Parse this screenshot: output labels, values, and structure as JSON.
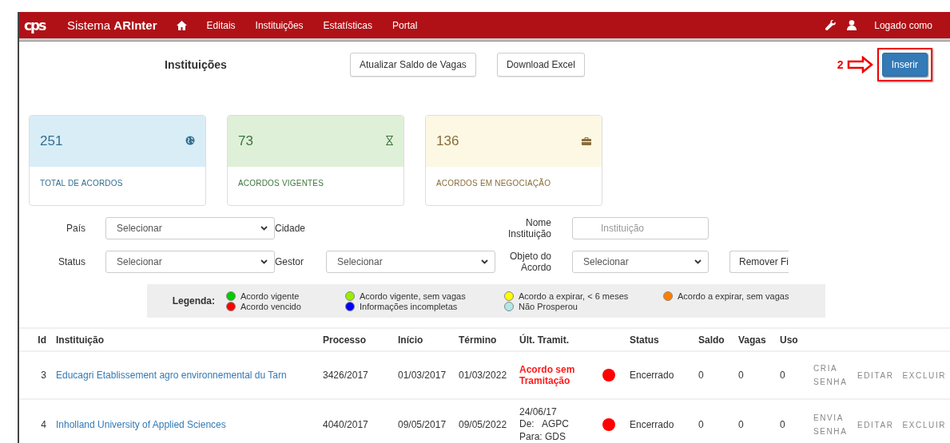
{
  "navbar": {
    "logo": "cps",
    "brand": "Sistema **ARInter**",
    "links": [
      "Editais",
      "Instituições",
      "Estatísticas",
      "Portal"
    ],
    "user_label": "Logado como"
  },
  "page_title": "Instituições",
  "toolbar_buttons": [
    "Atualizar Saldo de Vagas",
    "Download Excel"
  ],
  "insert_button": "Inserir",
  "annotation": {
    "label": "2"
  },
  "stat_cards": [
    {
      "value": "251",
      "label": "TOTAL DE ACORDOS",
      "color": "#d9edf7",
      "kind": "globe"
    },
    {
      "value": "73",
      "label": "ACORDOS VIGENTES",
      "color": "#dff0d8",
      "kind": "hourglass"
    },
    {
      "value": "136",
      "label": "ACORDOS EM NEGOCIAÇÃO",
      "color": "#fcf8e3",
      "kind": "briefcase"
    }
  ],
  "filters": [
    [
      {
        "label": "País",
        "kind": "select",
        "value": "Selecionar"
      },
      {
        "label": "Cidade",
        "kind": "none"
      },
      {
        "label": "Nome Instituição",
        "kind": "input",
        "placeholder": "Instituição"
      }
    ],
    [
      {
        "label": "Status",
        "kind": "select",
        "value": "Selecionar"
      },
      {
        "label": "Gestor",
        "kind": "select",
        "value": "Selecionar"
      },
      {
        "label": "Objeto do Acordo",
        "kind": "select",
        "value": "Selecionar"
      }
    ]
  ],
  "remove_filters_button": "Remover Fi",
  "legend": {
    "title": "Legenda:",
    "items": [
      {
        "label": "Acordo vigente",
        "color": "#00cc00"
      },
      {
        "label": "Acordo vigente, sem vagas",
        "color": "#99ee00"
      },
      {
        "label": "Acordo a expirar, < 6 meses",
        "color": "#ffff00"
      },
      {
        "label": "Acordo a expirar, sem vagas",
        "color": "#ff8000"
      },
      {
        "label": "Acordo vencido",
        "color": "#ff0000"
      },
      {
        "label": "Informações incompletas",
        "color": "#0000ff"
      },
      {
        "label": "Não Prosperou",
        "color": "#aee8e8"
      }
    ]
  },
  "table": {
    "columns": [
      "Id",
      "Instituição",
      "Processo",
      "Início",
      "Término",
      "Últ. Tramit.",
      "Status",
      "Saldo",
      "Vagas",
      "Uso"
    ],
    "rows": [
      {
        "id": "3",
        "institution": "Educagri Etablissement agro environnemental du Tarn",
        "process": "3426/2017",
        "start": "01/03/2017",
        "end": "01/03/2022",
        "last_step": {
          "kind": "alert",
          "lines": [
            "Acordo sem Tramitação"
          ]
        },
        "color": "#ff0000",
        "status": "Encerrado",
        "saldo": "0",
        "vagas": "0",
        "uso": "0",
        "actions": [
          "CRIA SENHA",
          "EDITAR",
          "EXCLUIR"
        ]
      },
      {
        "id": "4",
        "institution": "Inholland University of Applied Sciences",
        "process": "4040/2017",
        "start": "09/05/2017",
        "end": "09/05/2022",
        "last_step": {
          "kind": "log",
          "lines": [
            "24/06/17",
            "De:   AGPC",
            "Para: GDS"
          ]
        },
        "color": "#ff0000",
        "status": "Encerrado",
        "saldo": "0",
        "vagas": "0",
        "uso": "0",
        "actions": [
          "ENVIA SENHA",
          "EDITAR",
          "EXCLUIR"
        ]
      }
    ]
  }
}
